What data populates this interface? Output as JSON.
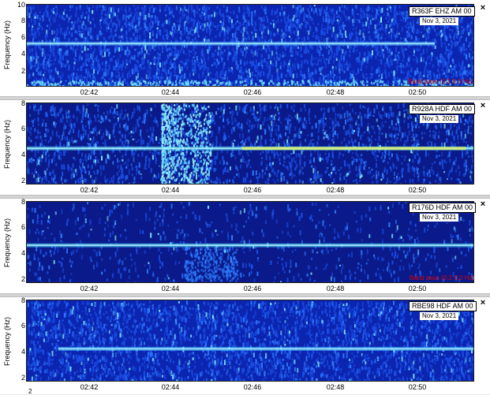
{
  "panels": [
    {
      "station": "R363F EHZ AM 00",
      "date": "Nov 3, 2021",
      "ylabel": "Frequency (Hz)",
      "yticks": [
        "10",
        "8",
        "6",
        "4",
        "2"
      ],
      "xticks": [
        "02:42",
        "02:44",
        "02:46",
        "02:48",
        "02:50"
      ],
      "bandpass": "Band pass (0.2-5.0 Hz)",
      "bandpass_visible": true,
      "close": "×"
    },
    {
      "station": "R928A HDF AM 00",
      "date": "Nov 3, 2021",
      "ylabel": "Frequency (Hz)",
      "yticks": [
        "8",
        "6",
        "4",
        "2"
      ],
      "xticks": [
        "02:42",
        "02:44",
        "02:46",
        "02:48",
        "02:50"
      ],
      "bandpass": "",
      "bandpass_visible": false,
      "close": "×"
    },
    {
      "station": "R176D HDF AM 00",
      "date": "Nov 3, 2021",
      "ylabel": "Frequency (Hz)",
      "yticks": [
        "8",
        "6",
        "4",
        "2"
      ],
      "xticks": [
        "02:42",
        "02:44",
        "02:46",
        "02:48",
        "02:50"
      ],
      "bandpass": "Band pass (0.2-5.0 Hz)",
      "bandpass_visible": true,
      "close": "×"
    },
    {
      "station": "RBE98 HDF AM 00",
      "date": "Nov 3, 2021",
      "ylabel": "Frequency (Hz)",
      "yticks": [
        "8",
        "6",
        "4",
        "2"
      ],
      "xticks": [
        "02:42",
        "02:44",
        "02:46",
        "02:48",
        "02:50"
      ],
      "bandpass": "",
      "bandpass_visible": false,
      "close": "×"
    }
  ],
  "bottom_partial_tick": "2",
  "colors": {
    "background_dark": "#0a1f9e",
    "noise_light": "#1e5cff",
    "band_cyan": "#5ae6ff",
    "band_yellow": "#e8f55a",
    "bandpass_text": "#e00000"
  }
}
